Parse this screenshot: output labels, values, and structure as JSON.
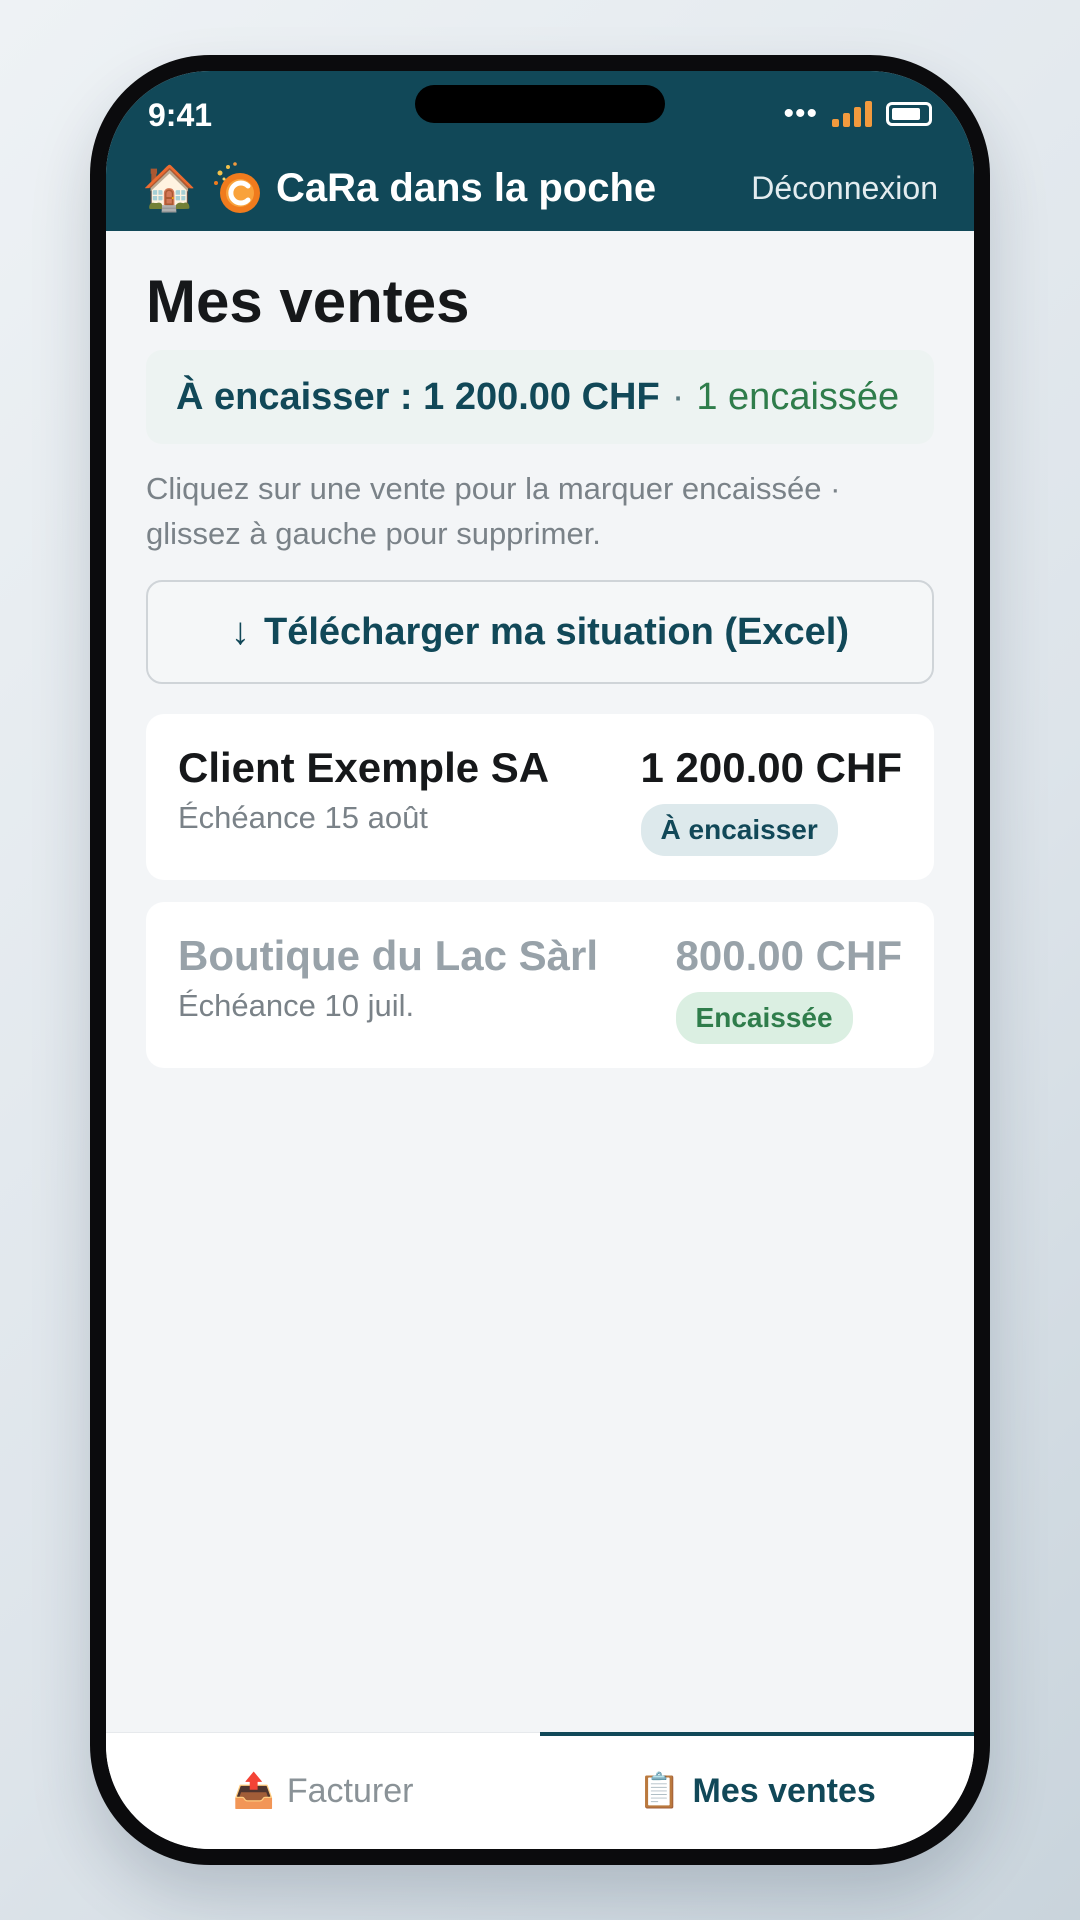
{
  "status_bar": {
    "time": "9:41"
  },
  "header": {
    "home_icon": "🏠",
    "logo_icon": "cara-logo-icon",
    "title": "CaRa dans la poche",
    "logout_label": "Déconnexion"
  },
  "page": {
    "title": "Mes ventes",
    "summary": {
      "to_collect": "À encaisser : 1 200.00 CHF",
      "separator": "·",
      "collected": "1 encaissée"
    },
    "hint": "Cliquez sur une vente pour la marquer encaissée · glissez à gauche pour supprimer.",
    "download": {
      "arrow": "↓",
      "label": "Télécharger ma situation (Excel)"
    }
  },
  "sales": [
    {
      "client": "Client Exemple SA",
      "due": "Échéance 15 août",
      "amount": "1 200.00 CHF",
      "status": "À encaisser"
    },
    {
      "client": "Boutique du Lac Sàrl",
      "due": "Échéance 10 juil.",
      "amount": "800.00 CHF",
      "status": "Encaissée"
    }
  ],
  "tabs": [
    {
      "icon": "📤",
      "label": "Facturer"
    },
    {
      "icon": "📋",
      "label": "Mes ventes"
    }
  ],
  "colors": {
    "brand": "#114858",
    "paid_green": "#2f7d4b",
    "signal_orange": "#f29a3e"
  }
}
